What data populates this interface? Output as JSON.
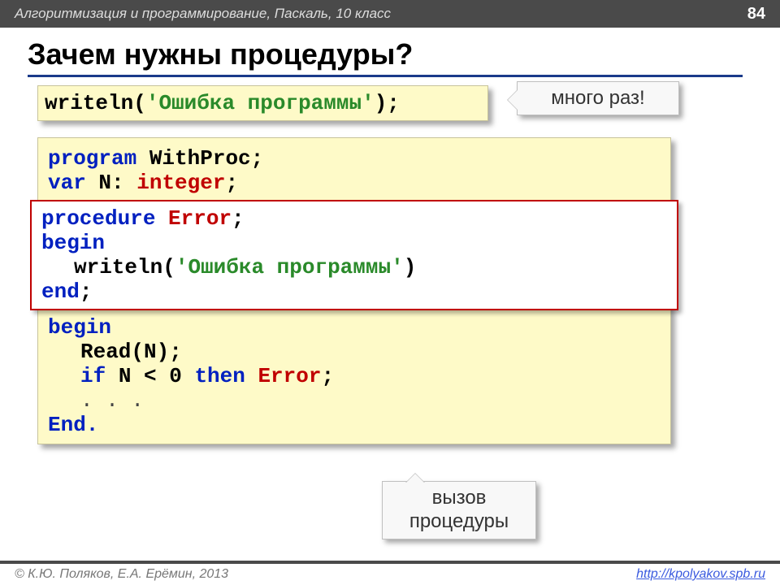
{
  "header": {
    "subject": "Алгоритмизация и программирование, Паскаль, 10 класс",
    "page_number": "84"
  },
  "title": "Зачем нужны процедуры?",
  "snippet_top": {
    "writeln": "writeln",
    "str_open": "'",
    "str_text": "Ошибка программы",
    "str_close": "'",
    "paren_close": ");"
  },
  "callout_top": "много раз!",
  "main": {
    "l1_kw": "program ",
    "l1_name": "WithProc;",
    "l2_kw": "var ",
    "l2_var": "N: ",
    "l2_type": "integer",
    "l2_semi": ";",
    "proc": {
      "p1_kw": "procedure ",
      "p1_name": "Error",
      "p1_semi": ";",
      "p2": "begin",
      "p3_fn": "writeln",
      "p3_paren": "(",
      "p3_q1": "'",
      "p3_txt": "Ошибка программы",
      "p3_q2": "'",
      "p3_close": ")",
      "p4": "end",
      "p4_semi": ";"
    },
    "b1": "begin",
    "b2_fn": "Read",
    "b2_arg": "(N);",
    "b3_if": "if ",
    "b3_cond": "N < 0 ",
    "b3_then": "then ",
    "b3_call": "Error",
    "b3_semi": ";",
    "b4": ". . .",
    "b5": "End."
  },
  "callout_bottom_l1": "вызов",
  "callout_bottom_l2": "процедуры",
  "footer": {
    "copyright": "© К.Ю. Поляков, Е.А. Ерёмин, 2013",
    "url": "http://kpolyakov.spb.ru"
  }
}
